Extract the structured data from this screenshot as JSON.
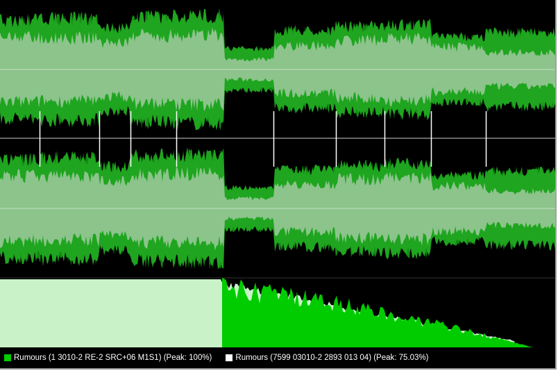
{
  "colors": {
    "background": "#000000",
    "series_a": "#00cc00",
    "series_a_edge": "#138a13",
    "series_b": "#ffffff",
    "overlap": "#8cc48c",
    "spectrum_b": "#c9f2c9",
    "center_line": "#b9d9b9"
  },
  "legend": [
    {
      "label": "Rumours (1 3010-2 RE-2 SRC+06 M1S1) (Peak: 100%)",
      "swatch": "#00cc00"
    },
    {
      "label": "Rumours (7599 03010-2 2893 013 04) (Peak: 75.03%)",
      "swatch": "#ffffff"
    }
  ],
  "chart_data": {
    "type": "area",
    "panels": [
      "channel-1-waveform",
      "channel-2-waveform",
      "spectrum"
    ],
    "series": [
      {
        "name": "Rumours (1 3010-2 RE-2 SRC+06 M1S1)",
        "peak_percent": 100
      },
      {
        "name": "Rumours (7599 03010-2 2893 013 04)",
        "peak_percent": 75.03
      }
    ],
    "track_markers_fraction": [
      0.071,
      0.179,
      0.235,
      0.317,
      0.493,
      0.605,
      0.693,
      0.776,
      0.875
    ],
    "segment_levels": [
      {
        "from": 0.0,
        "to": 0.071,
        "a": 0.82,
        "b": 0.58
      },
      {
        "from": 0.071,
        "to": 0.179,
        "a": 0.85,
        "b": 0.56
      },
      {
        "from": 0.179,
        "to": 0.235,
        "a": 0.7,
        "b": 0.48
      },
      {
        "from": 0.235,
        "to": 0.317,
        "a": 0.88,
        "b": 0.6
      },
      {
        "from": 0.317,
        "to": 0.405,
        "a": 0.9,
        "b": 0.62
      },
      {
        "from": 0.405,
        "to": 0.493,
        "a": 0.35,
        "b": 0.18
      },
      {
        "from": 0.493,
        "to": 0.605,
        "a": 0.65,
        "b": 0.42
      },
      {
        "from": 0.605,
        "to": 0.693,
        "a": 0.72,
        "b": 0.52
      },
      {
        "from": 0.693,
        "to": 0.776,
        "a": 0.75,
        "b": 0.55
      },
      {
        "from": 0.776,
        "to": 0.875,
        "a": 0.55,
        "b": 0.4
      },
      {
        "from": 0.875,
        "to": 1.0,
        "a": 0.62,
        "b": 0.3
      }
    ],
    "spectrum_profile": {
      "b_flat_until": 0.4,
      "b_end": 0.93,
      "a_start": 0.4,
      "a_end": 0.96,
      "a_level": 1.0,
      "b_level": 0.98
    }
  }
}
